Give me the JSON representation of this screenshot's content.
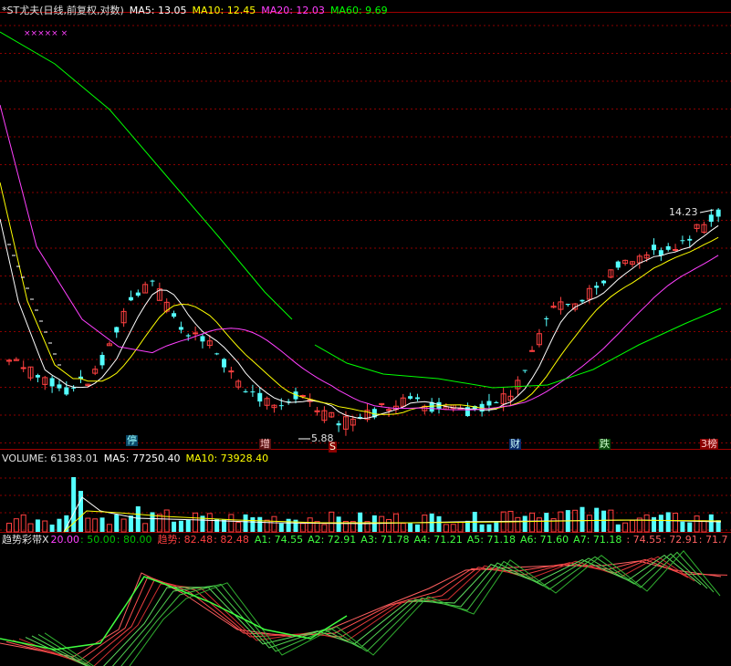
{
  "main_header": {
    "title": "*ST尤夫(日线,前复权,对数)",
    "ma5_label": "MA5: 13.05",
    "ma10_label": "MA10: 12.45",
    "ma20_label": "MA20: 12.03",
    "ma60_label": "MA60: 9.69"
  },
  "volume_header": {
    "label": "VOLUME: 61383.01",
    "ma5_label": "MA5: 77250.40",
    "ma10_label": "MA10: 73928.40"
  },
  "trend_header": {
    "name": "趋势彩带X",
    "p1": "20.00",
    "p2": ": 50.00",
    "p3": ": 80.00",
    "trend_label": "趋势: 82.48",
    "trend_val2": ": 82.48",
    "a1": "A1: 74.55",
    "a2": "A2: 72.91",
    "a3": "A3: 71.78",
    "a4": "A4: 71.21",
    "a5": "A5: 71.18",
    "a6": "A6: 71.60",
    "a7": "A7: 71.18",
    "tail1": ": 74.55",
    "tail2": ": 72.91",
    "tail3": ": 71.7"
  },
  "annotations": {
    "high_label": "14.23",
    "low_label": "5.88",
    "marker_ting": "停",
    "marker_zeng": "增",
    "marker_s": "S",
    "marker_cai": "财",
    "marker_die": "跌",
    "marker_bang": "榜",
    "marker_3": "3",
    "x_marks": "×××××   ×"
  },
  "colors": {
    "up": "#ff4040",
    "down": "#54ffff",
    "ma5": "#ffffff",
    "ma10": "#ffff00",
    "ma20": "#ff40ff",
    "ma60": "#00ff00",
    "grid": "#8b0000"
  },
  "chart_data": {
    "type": "candlestick",
    "price_scale": "log",
    "high": 14.23,
    "low": 5.88,
    "last": {
      "ma5": 13.05,
      "ma10": 12.45,
      "ma20": 12.03,
      "ma60": 9.69
    },
    "volume_last": {
      "volume": 61383.01,
      "ma5": 77250.4,
      "ma10": 73928.4
    }
  }
}
